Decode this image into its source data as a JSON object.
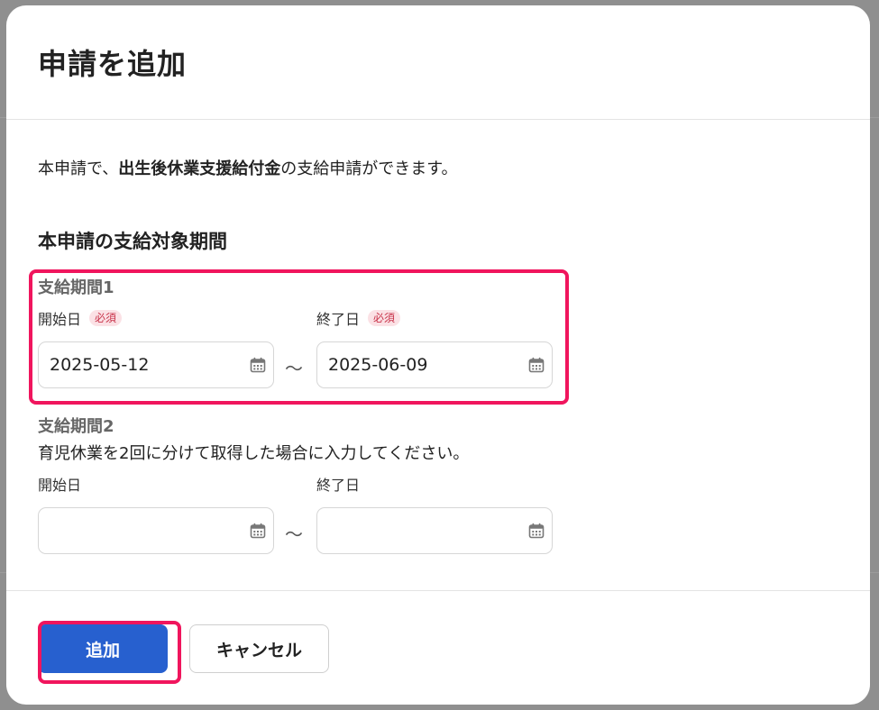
{
  "dialog": {
    "title": "申請を追加",
    "intro_prefix": "本申請で、",
    "intro_bold": "出生後休業支援給付金",
    "intro_suffix": "の支給申請ができます。",
    "section_title": "本申請の支給対象期間"
  },
  "period1": {
    "title": "支給期間1",
    "start_label": "開始日",
    "end_label": "終了日",
    "required_badge": "必須",
    "start_value": "2025-05-12",
    "end_value": "2025-06-09",
    "separator": "～"
  },
  "period2": {
    "title": "支給期間2",
    "note": "育児休業を2回に分けて取得した場合に入力してください。",
    "start_label": "開始日",
    "end_label": "終了日",
    "start_value": "",
    "end_value": "",
    "separator": "～"
  },
  "footer": {
    "add_label": "追加",
    "cancel_label": "キャンセル"
  },
  "icons": {
    "calendar": "calendar-icon"
  },
  "colors": {
    "primary": "#2760cf",
    "highlight": "#f0155d",
    "required_text": "#c8334a",
    "required_bg": "#fbe1e5"
  }
}
